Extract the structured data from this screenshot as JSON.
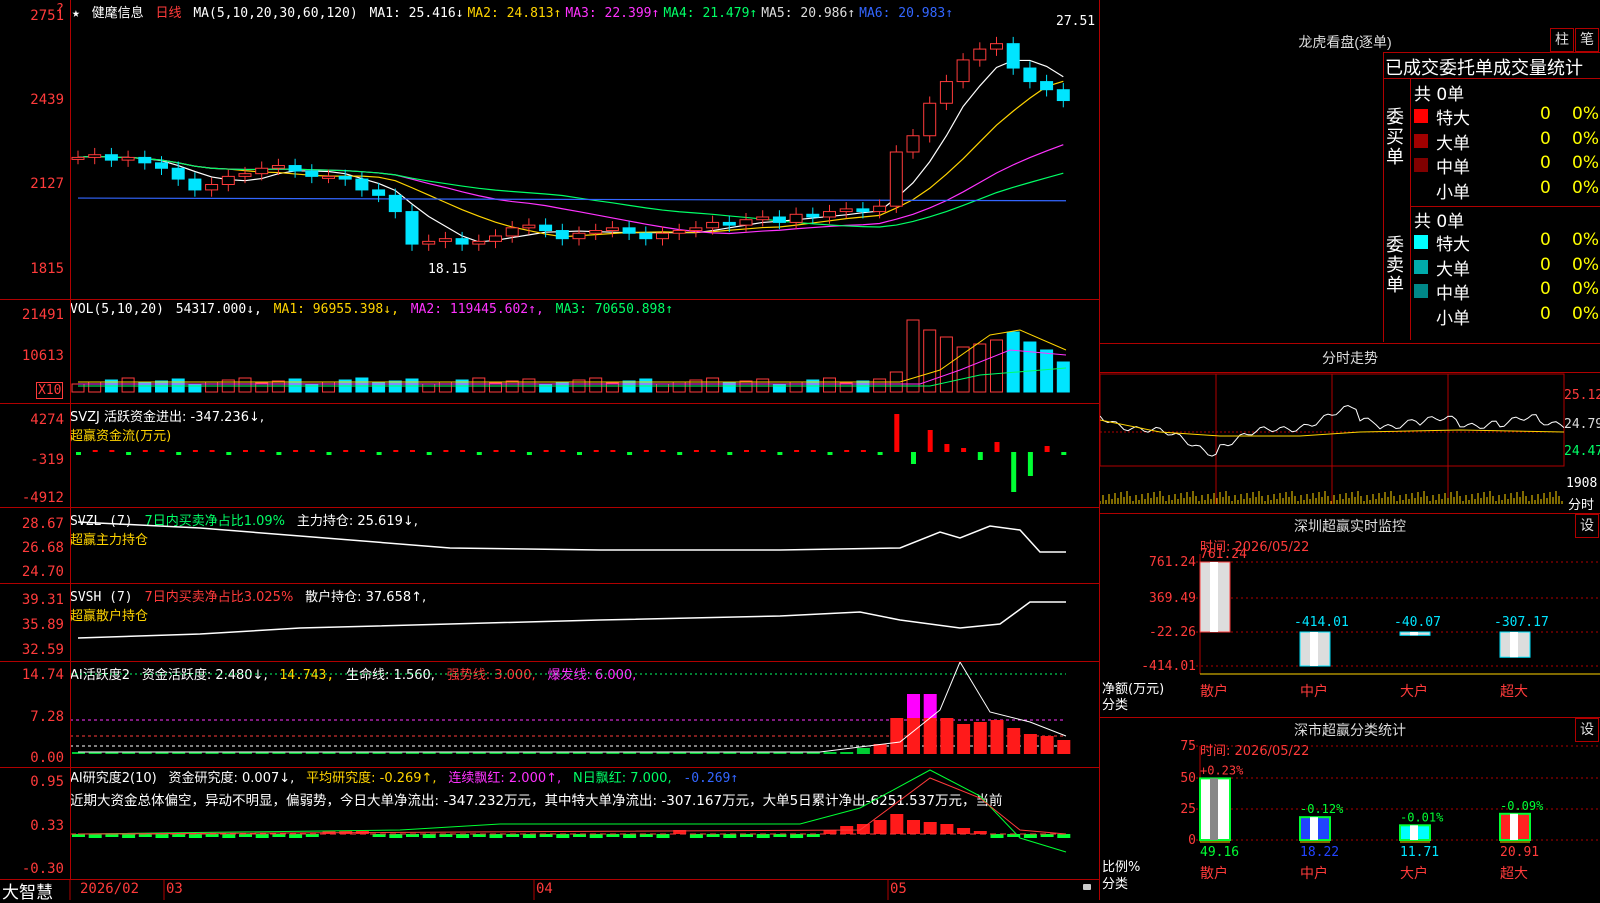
{
  "stock": {
    "name": "健麾信息",
    "period": "日线",
    "star": "★",
    "question": "?"
  },
  "main": {
    "ma_label": "MA(5,10,20,30,60,120)",
    "ma": [
      {
        "label": "MA1:",
        "value": "25.416",
        "arrow": "↓",
        "color": "#ffffff"
      },
      {
        "label": "MA2:",
        "value": "24.813",
        "arrow": "↑",
        "color": "#ffd400"
      },
      {
        "label": "MA3:",
        "value": "22.399",
        "arrow": "↑",
        "color": "#ff33ff"
      },
      {
        "label": "MA4:",
        "value": "21.479",
        "arrow": "↑",
        "color": "#00ff66"
      },
      {
        "label": "MA5:",
        "value": "20.986",
        "arrow": "↑",
        "color": "#dddddd"
      },
      {
        "label": "MA6:",
        "value": "20.983",
        "arrow": "↑",
        "color": "#3366ff"
      }
    ],
    "y_labels": [
      "2751",
      "2439",
      "2127",
      "1815"
    ],
    "high_label": "27.51",
    "low_label": "18.15"
  },
  "vol": {
    "label": "VOL(5,10,20)",
    "value": "54317.000↓,",
    "ma1": "MA1: 96955.398↓,",
    "ma2": "MA2: 119445.602↑,",
    "ma3": "MA3: 70650.898↑",
    "y_labels": [
      "21491",
      "10613"
    ],
    "unit": "X10"
  },
  "svzj": {
    "label": "SVZJ  活跃资金进出: -347.236↓,",
    "sub": "超赢资金流(万元)",
    "y_labels": [
      "4274",
      "-319",
      "-4912"
    ]
  },
  "svzl": {
    "label": "SVZL (7)",
    "part2": "7日内买卖净占比1.09%",
    "part3": "主力持仓: 25.619↓,",
    "sub": "超赢主力持仓",
    "y_labels": [
      "28.67",
      "26.68",
      "24.70"
    ]
  },
  "svsh": {
    "label": "SVSH (7)",
    "part2": "7日内买卖净占比3.025%",
    "part3": "散户持仓: 37.658↑,",
    "sub": "超赢散户持仓",
    "y_labels": [
      "39.31",
      "35.89",
      "32.59"
    ]
  },
  "ai1": {
    "label": "AI活跃度2",
    "p1": "资金活跃度: 2.480↓,",
    "p2": "14.743,",
    "p3": "生命线: 1.560,",
    "p4": "强势线: 3.000,",
    "p5": "爆发线: 6.000,",
    "y_labels": [
      "14.74",
      "7.28",
      "0.00"
    ]
  },
  "ai2": {
    "label": "AI研究度2(10)",
    "p1": "资金研究度: 0.007↓,",
    "p2": "平均研究度: -0.269↑,",
    "p3": "连续飘红: 2.000↑,",
    "p4": "N日飘红: 7.000,",
    "p5": "-0.269↑",
    "comment": "近期大资金总体偏空，异动不明显，偏弱势，今日大单净流出: -347.232万元，其中特大单净流出: -307.167万元，大单5日累计净出-6251.537万元，当前",
    "y_labels": [
      "0.95",
      "0.33",
      "-0.30"
    ]
  },
  "bottom": {
    "brand": "大智慧",
    "dates": [
      "2026/02",
      "03",
      "04",
      "05"
    ]
  },
  "longhu": {
    "title": "龙虎看盘(逐单)",
    "btn1": "柱",
    "btn2": "笔",
    "header": "已成交委托单成交量统计",
    "buy_label": "委买单",
    "sell_label": "委卖单",
    "buy_total": "共 0单",
    "sell_total": "共 0单",
    "buy_rows": [
      {
        "name": "特大",
        "count": "0",
        "pct": "0%",
        "color": "#ff0000"
      },
      {
        "name": "大单",
        "count": "0",
        "pct": "0%",
        "color": "#a00000"
      },
      {
        "name": "中单",
        "count": "0",
        "pct": "0%",
        "color": "#800000"
      },
      {
        "name": "小单",
        "count": "0",
        "pct": "0%",
        "color": "#000000"
      }
    ],
    "sell_rows": [
      {
        "name": "特大",
        "count": "0",
        "pct": "0%",
        "color": "#00ffff"
      },
      {
        "name": "大单",
        "count": "0",
        "pct": "0%",
        "color": "#00aaaa"
      },
      {
        "name": "中单",
        "count": "0",
        "pct": "0%",
        "color": "#008888"
      },
      {
        "name": "小单",
        "count": "0",
        "pct": "0%",
        "color": "#000000"
      }
    ]
  },
  "fenshi": {
    "title": "分时走势",
    "y_labels": [
      "25.12",
      "24.79",
      "24.47"
    ],
    "vol_label": "1908",
    "unit": "分时"
  },
  "monitor": {
    "title": "深圳超赢实时监控",
    "btn": "设",
    "time": "时间: 2026/05/22",
    "y_labels": [
      "761.24",
      "369.49",
      "-22.26",
      "-414.01"
    ],
    "bars": [
      {
        "cat": "散户",
        "value": "761.24"
      },
      {
        "cat": "中户",
        "value": "-414.01"
      },
      {
        "cat": "大户",
        "value": "-40.07"
      },
      {
        "cat": "超大",
        "value": "-307.17"
      }
    ],
    "unit": "净额(万元)",
    "cat_label": "分类"
  },
  "classify": {
    "title": "深市超赢分类统计",
    "btn": "设",
    "time": "时间: 2026/05/22",
    "y_labels": [
      "75",
      "50",
      "25",
      "0"
    ],
    "bars": [
      {
        "cat": "散户",
        "value": "49.16",
        "delta": "+0.23%",
        "color": "#ffffff"
      },
      {
        "cat": "中户",
        "value": "18.22",
        "delta": "-0.12%",
        "color": "#2244ff"
      },
      {
        "cat": "大户",
        "value": "11.71",
        "delta": "-0.01%",
        "color": "#00ffff"
      },
      {
        "cat": "超大",
        "value": "20.91",
        "delta": "-0.09%",
        "color": "#ff2222"
      }
    ],
    "unit": "比例%",
    "cat_label": "分类"
  }
}
